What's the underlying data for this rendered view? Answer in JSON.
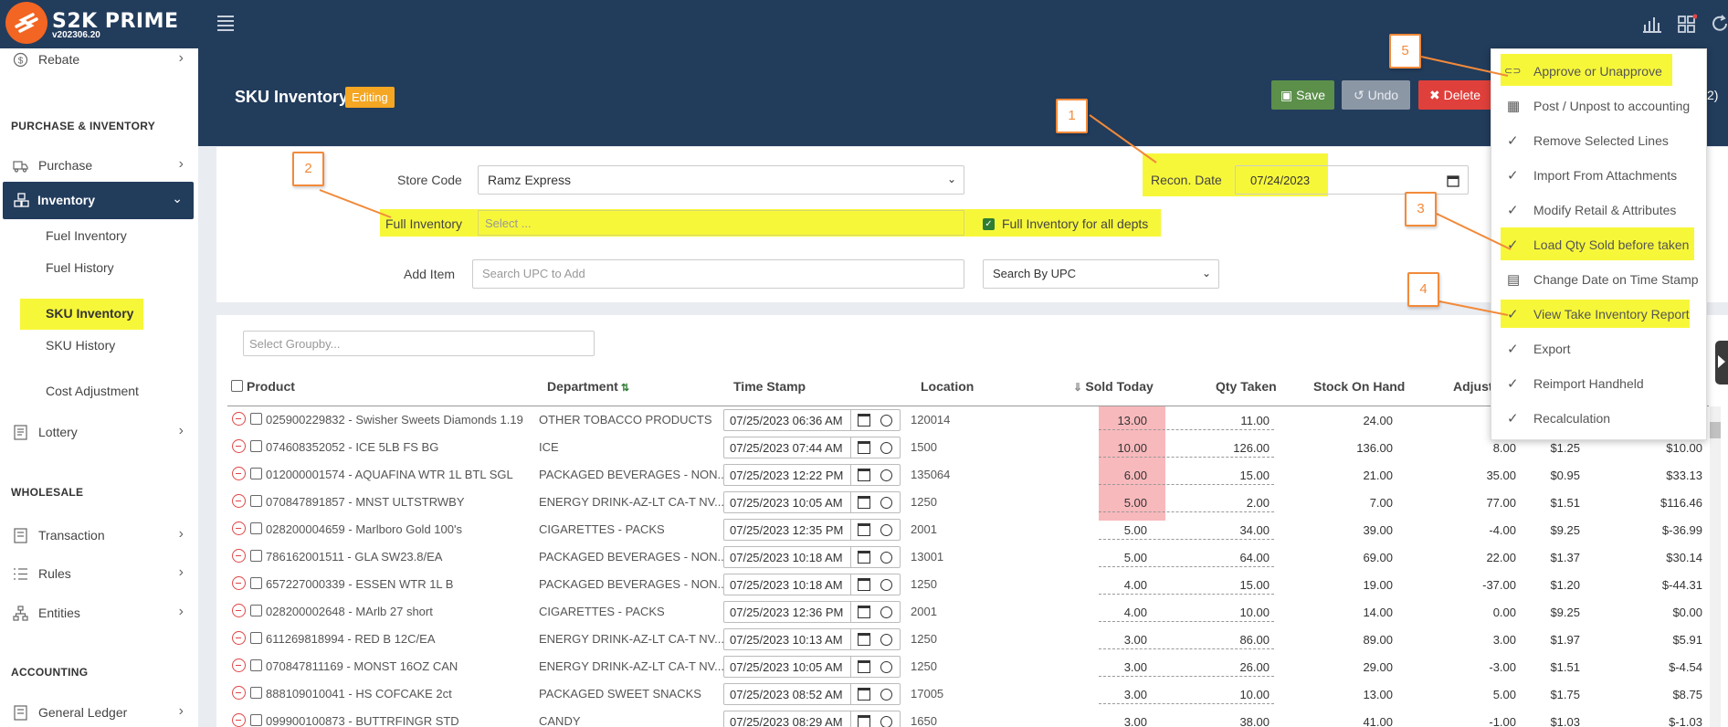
{
  "app": {
    "name": "S2K PRIME",
    "version": "v202306.20"
  },
  "sidebar": {
    "rebate": "Rebate",
    "section_purchase": "PURCHASE & INVENTORY",
    "purchase": "Purchase",
    "inventory": "Inventory",
    "inventory_sub": [
      "Fuel Inventory",
      "Fuel History",
      "SKU Inventory",
      "SKU History",
      "Cost Adjustment"
    ],
    "lottery": "Lottery",
    "section_wholesale": "WHOLESALE",
    "transaction": "Transaction",
    "rules": "Rules",
    "entities": "Entities",
    "section_accounting": "ACCOUNTING",
    "general_ledger": "General Ledger"
  },
  "header": {
    "title": "SKU Inventory",
    "badge": "Editing",
    "save": "Save",
    "undo": "Undo",
    "delete": "Delete",
    "right_fragment": "2)"
  },
  "form": {
    "store_code_label": "Store Code",
    "store_code_value": "Ramz Express",
    "full_inventory_label": "Full Inventory",
    "full_inventory_placeholder": "Select ...",
    "full_inventory_all_label": "Full Inventory for all depts",
    "recon_date_label": "Recon. Date",
    "recon_date_value": "07/24/2023",
    "add_item_label": "Add Item",
    "add_item_placeholder": "Search UPC to Add",
    "search_by_value": "Search By UPC"
  },
  "grid": {
    "groupby_placeholder": "Select Groupby...",
    "headers": {
      "product": "Product",
      "department": "Department",
      "timestamp": "Time Stamp",
      "location": "Location",
      "sold_today": "Sold Today",
      "qty_taken": "Qty Taken",
      "stock_on_hand": "Stock On Hand",
      "adjust": "Adjust"
    },
    "rows": [
      {
        "product": "025900229832 - Swisher Sweets Diamonds 1.19",
        "department": "OTHER TOBACCO PRODUCTS",
        "timestamp": "07/25/2023 06:36 AM",
        "location": "120014",
        "sold": "13.00",
        "qty": "11.00",
        "stock": "24.00",
        "adjust": "",
        "cost": "",
        "total": ""
      },
      {
        "product": "074608352052 - ICE 5LB FS BG",
        "department": "ICE",
        "timestamp": "07/25/2023 07:44 AM",
        "location": "1500",
        "sold": "10.00",
        "qty": "126.00",
        "stock": "136.00",
        "adjust": "8.00",
        "cost": "$1.25",
        "total": "$10.00"
      },
      {
        "product": "012000001574 - AQUAFINA WTR 1L BTL SGL",
        "department": "PACKAGED BEVERAGES - NON...",
        "timestamp": "07/25/2023 12:22 PM",
        "location": "135064",
        "sold": "6.00",
        "qty": "15.00",
        "stock": "21.00",
        "adjust": "35.00",
        "cost": "$0.95",
        "total": "$33.13"
      },
      {
        "product": "070847891857 - MNST ULTSTRWBY",
        "department": "ENERGY DRINK-AZ-LT CA-T NV...",
        "timestamp": "07/25/2023 10:05 AM",
        "location": "1250",
        "sold": "5.00",
        "qty": "2.00",
        "stock": "7.00",
        "adjust": "77.00",
        "cost": "$1.51",
        "total": "$116.46"
      },
      {
        "product": "028200004659 - Marlboro Gold 100's",
        "department": "CIGARETTES - PACKS",
        "timestamp": "07/25/2023 12:35 PM",
        "location": "2001",
        "sold": "5.00",
        "qty": "34.00",
        "stock": "39.00",
        "adjust": "-4.00",
        "cost": "$9.25",
        "total": "$-36.99"
      },
      {
        "product": "786162001511 - GLA SW23.8/EA",
        "department": "PACKAGED BEVERAGES - NON...",
        "timestamp": "07/25/2023 10:18 AM",
        "location": "13001",
        "sold": "5.00",
        "qty": "64.00",
        "stock": "69.00",
        "adjust": "22.00",
        "cost": "$1.37",
        "total": "$30.14"
      },
      {
        "product": "657227000339 - ESSEN WTR 1L B",
        "department": "PACKAGED BEVERAGES - NON...",
        "timestamp": "07/25/2023 10:18 AM",
        "location": "1250",
        "sold": "4.00",
        "qty": "15.00",
        "stock": "19.00",
        "adjust": "-37.00",
        "cost": "$1.20",
        "total": "$-44.31"
      },
      {
        "product": "028200002648 - MArlb 27 short",
        "department": "CIGARETTES - PACKS",
        "timestamp": "07/25/2023 12:36 PM",
        "location": "2001",
        "sold": "4.00",
        "qty": "10.00",
        "stock": "14.00",
        "adjust": "0.00",
        "cost": "$9.25",
        "total": "$0.00"
      },
      {
        "product": "611269818994 - RED B 12C/EA",
        "department": "ENERGY DRINK-AZ-LT CA-T NV...",
        "timestamp": "07/25/2023 10:13 AM",
        "location": "1250",
        "sold": "3.00",
        "qty": "86.00",
        "stock": "89.00",
        "adjust": "3.00",
        "cost": "$1.97",
        "total": "$5.91"
      },
      {
        "product": "070847811169 - MONST 16OZ CAN",
        "department": "ENERGY DRINK-AZ-LT CA-T NV...",
        "timestamp": "07/25/2023 10:05 AM",
        "location": "1250",
        "sold": "3.00",
        "qty": "26.00",
        "stock": "29.00",
        "adjust": "-3.00",
        "cost": "$1.51",
        "total": "$-4.54"
      },
      {
        "product": "888109010041 - HS COFCAKE 2ct",
        "department": "PACKAGED SWEET SNACKS",
        "timestamp": "07/25/2023 08:52 AM",
        "location": "17005",
        "sold": "3.00",
        "qty": "10.00",
        "stock": "13.00",
        "adjust": "5.00",
        "cost": "$1.75",
        "total": "$8.75"
      },
      {
        "product": "099900100873 - BUTTRFINGR STD",
        "department": "CANDY",
        "timestamp": "07/25/2023 08:29 AM",
        "location": "1650",
        "sold": "3.00",
        "qty": "38.00",
        "stock": "41.00",
        "adjust": "-1.00",
        "cost": "$1.03",
        "total": "$-1.03"
      }
    ]
  },
  "menu": {
    "items": [
      {
        "label": "Approve or Unapprove",
        "icon": "toggle-icon"
      },
      {
        "label": "Post / Unpost to accounting",
        "icon": "calculator-icon"
      },
      {
        "label": "Remove Selected Lines",
        "icon": "check-icon"
      },
      {
        "label": "Import From Attachments",
        "icon": "check-icon"
      },
      {
        "label": "Modify Retail & Attributes",
        "icon": "check-icon"
      },
      {
        "label": "Load Qty Sold before taken",
        "icon": "check-icon"
      },
      {
        "label": "Change Date on Time Stamp",
        "icon": "calendar-icon"
      },
      {
        "label": "View Take Inventory Report",
        "icon": "check-icon"
      },
      {
        "label": "Export",
        "icon": "check-icon"
      },
      {
        "label": "Reimport Handheld",
        "icon": "check-icon"
      },
      {
        "label": "Recalculation",
        "icon": "check-icon"
      }
    ]
  },
  "callouts": [
    "1",
    "2",
    "3",
    "4",
    "5"
  ],
  "colors": {
    "navy": "#223c5c",
    "highlight": "#f7f73a",
    "orange": "#f28a3a",
    "save_green": "#5b8f4a",
    "delete_red": "#e0403b",
    "editing_badge": "#f5a623",
    "sold_highlight": "#f8b9bc"
  }
}
